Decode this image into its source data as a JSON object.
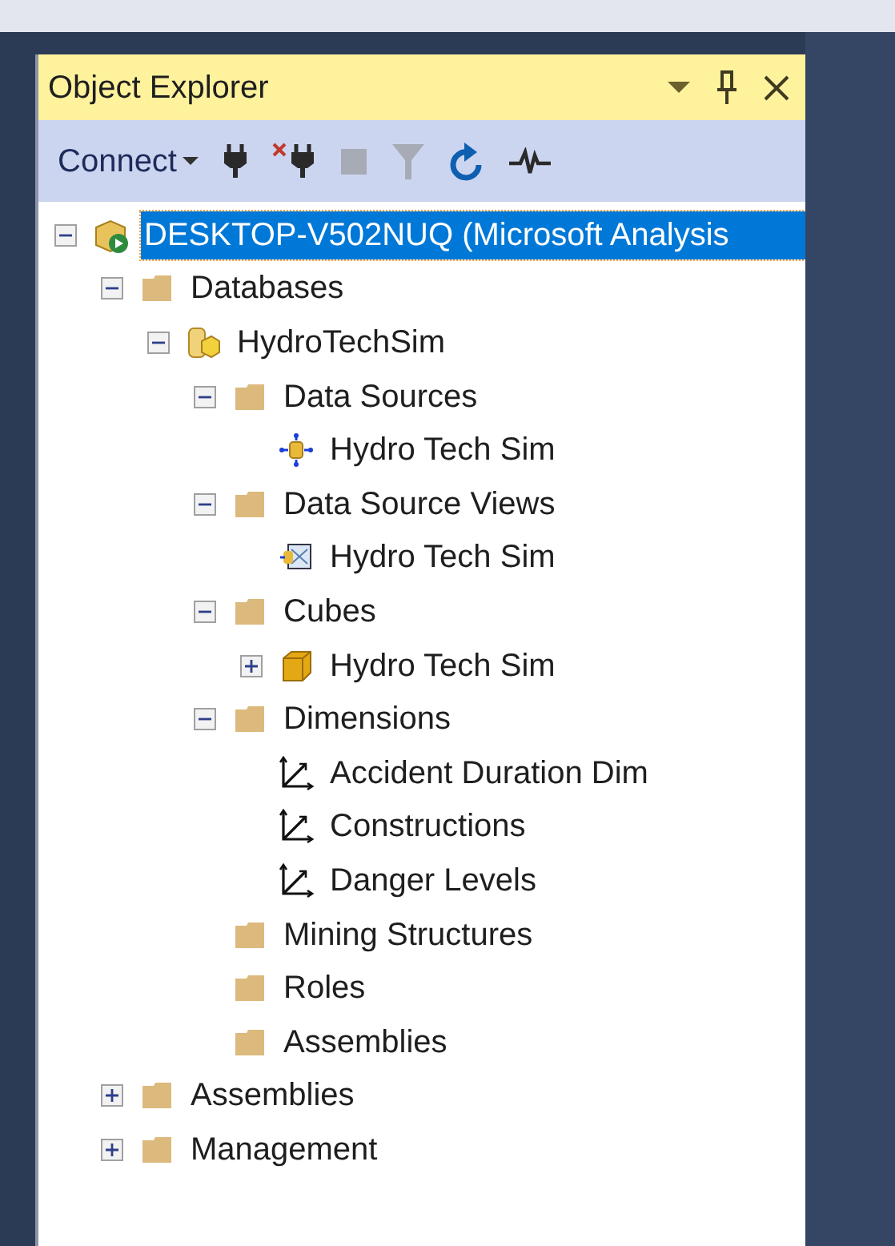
{
  "panel": {
    "title": "Object Explorer"
  },
  "toolbar": [
    {
      "kind": "connect",
      "label": "Connect",
      "disabled": false
    },
    {
      "kind": "plug",
      "disabled": false
    },
    {
      "kind": "unplug",
      "disabled": false
    },
    {
      "kind": "stop",
      "disabled": true
    },
    {
      "kind": "filter",
      "disabled": true
    },
    {
      "kind": "refresh",
      "disabled": false
    },
    {
      "kind": "activity",
      "disabled": false
    }
  ],
  "tree": [
    {
      "kind": "server",
      "label": "DESKTOP-V502NUQ (Microsoft Analysis",
      "expanded": true,
      "selected": true,
      "children": [
        {
          "kind": "folder",
          "label": "Databases",
          "expanded": true,
          "selected": false,
          "children": [
            {
              "kind": "database",
              "label": "HydroTechSim",
              "expanded": true,
              "selected": false,
              "children": [
                {
                  "kind": "folder",
                  "label": "Data Sources",
                  "expanded": true,
                  "selected": false,
                  "children": [
                    {
                      "kind": "datasource",
                      "label": "Hydro Tech Sim",
                      "selected": false
                    }
                  ]
                },
                {
                  "kind": "folder",
                  "label": "Data Source Views",
                  "expanded": true,
                  "selected": false,
                  "children": [
                    {
                      "kind": "dsv",
                      "label": "Hydro Tech Sim",
                      "selected": false
                    }
                  ]
                },
                {
                  "kind": "folder",
                  "label": "Cubes",
                  "expanded": true,
                  "selected": false,
                  "children": [
                    {
                      "kind": "cube",
                      "label": "Hydro Tech Sim",
                      "expanded": false,
                      "selected": false
                    }
                  ]
                },
                {
                  "kind": "folder",
                  "label": "Dimensions",
                  "expanded": true,
                  "selected": false,
                  "children": [
                    {
                      "kind": "dimension",
                      "label": "Accident Duration Dim",
                      "selected": false
                    },
                    {
                      "kind": "dimension",
                      "label": "Constructions",
                      "selected": false
                    },
                    {
                      "kind": "dimension",
                      "label": "Danger Levels",
                      "selected": false
                    }
                  ]
                },
                {
                  "kind": "folder",
                  "label": "Mining Structures",
                  "selected": false
                },
                {
                  "kind": "folder",
                  "label": "Roles",
                  "selected": false
                },
                {
                  "kind": "folder",
                  "label": "Assemblies",
                  "selected": false
                }
              ]
            }
          ]
        },
        {
          "kind": "folder",
          "label": "Assemblies",
          "expanded": false,
          "selected": false
        },
        {
          "kind": "folder",
          "label": "Management",
          "expanded": false,
          "selected": false
        }
      ]
    }
  ]
}
